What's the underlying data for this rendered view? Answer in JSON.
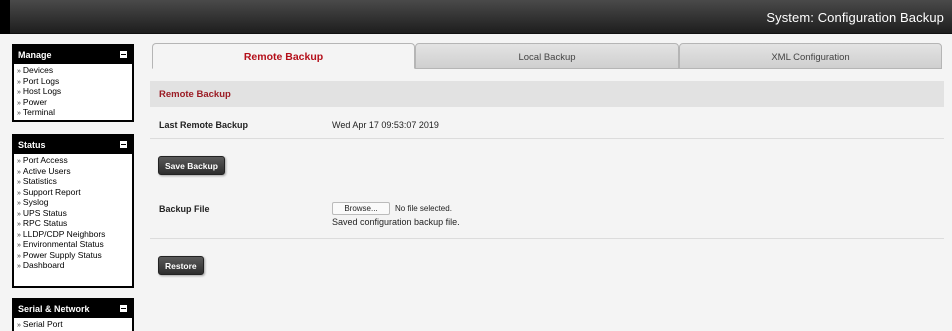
{
  "header": {
    "title": "System: Configuration Backup"
  },
  "sidebar": {
    "manage": {
      "title": "Manage",
      "items": [
        "Devices",
        "Port Logs",
        "Host Logs",
        "Power",
        "Terminal"
      ]
    },
    "status": {
      "title": "Status",
      "items": [
        "Port Access",
        "Active Users",
        "Statistics",
        "Support Report",
        "Syslog",
        "UPS Status",
        "RPC Status",
        "LLDP/CDP Neighbors",
        "Environmental Status",
        "Power Supply Status",
        "Dashboard"
      ]
    },
    "serial_network": {
      "title": "Serial & Network",
      "items": [
        "Serial Port"
      ]
    }
  },
  "tabs": [
    {
      "label": "Remote Backup",
      "active": true
    },
    {
      "label": "Local Backup",
      "active": false
    },
    {
      "label": "XML Configuration",
      "active": false
    }
  ],
  "section": {
    "title": "Remote Backup"
  },
  "last_backup": {
    "label": "Last Remote Backup",
    "value": "Wed Apr 17 09:53:07 2019"
  },
  "save_button": "Save Backup",
  "backup_file": {
    "label": "Backup File",
    "browse_label": "Browse...",
    "file_status": "No file selected.",
    "note": "Saved configuration backup file."
  },
  "restore_button": "Restore",
  "colors": {
    "accent": "#b40f1a",
    "section_text": "#9b1b24",
    "header_bg": "#2a2a2a"
  }
}
